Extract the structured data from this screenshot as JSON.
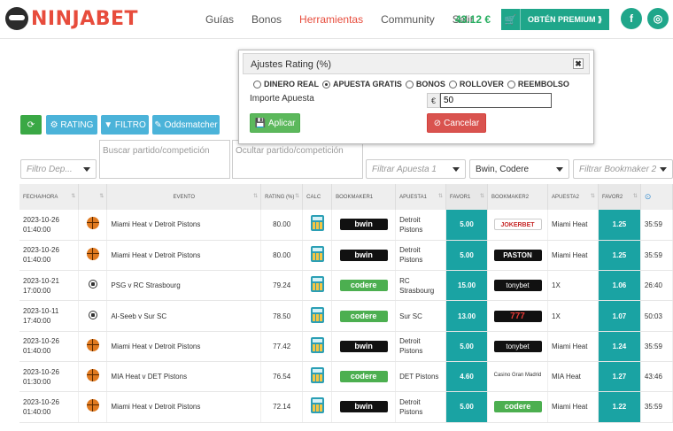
{
  "header": {
    "logo_text": "NINJABET",
    "nav": [
      "Guías",
      "Bonos",
      "Herramientas",
      "Community",
      "Salir"
    ],
    "active_nav": "Herramientas",
    "balance": "43.12 €",
    "premium_label": "OBTÉN PREMIUM ⟫",
    "social": [
      "f",
      "◎"
    ]
  },
  "toolbar": {
    "refresh_icon": "⟳",
    "rating_label": "⚙ RATING",
    "filtro_label": "▼ FILTRO",
    "odds_label": "✎ Oddsmatcher"
  },
  "filters": {
    "deporte_placeholder": "Filtro Dep...",
    "buscar_placeholder": "Buscar partido/competición",
    "ocultar_placeholder": "Ocultar partido/competición",
    "apuesta1_placeholder": "Filtrar Apuesta 1",
    "bookmaker1_value": "Bwin, Codere",
    "bookmaker2_placeholder": "Filtrar Bookmaker 2"
  },
  "modal": {
    "title": "Ajustes Rating (%)",
    "close": "✖",
    "radios": [
      {
        "label": "DINERO REAL",
        "checked": false
      },
      {
        "label": "APUESTA GRATIS",
        "checked": true
      },
      {
        "label": "BONOS",
        "checked": false
      },
      {
        "label": "ROLLOVER",
        "checked": false
      },
      {
        "label": "REEMBOLSO",
        "checked": false
      }
    ],
    "importe_label": "Importe Apuesta",
    "currency": "€",
    "importe_value": "50",
    "aplicar_label": "Aplicar",
    "cancelar_label": "Cancelar"
  },
  "table": {
    "headers": [
      "FECHA/HORA",
      "",
      "EVENTO",
      "RATING (%)",
      "CALC",
      "BOOKMAKER1",
      "APUESTA1",
      "FAVOR1",
      "BOOKMAKER2",
      "APUESTA2",
      "FAVOR2",
      "⊙"
    ],
    "rows": [
      {
        "date": "2023-10-26",
        "time": "01:40:00",
        "sport": "basket",
        "event": "Miami Heat v Detroit Pistons",
        "rating": "80.00",
        "bk1": "bwin",
        "bk1_label": "bwin",
        "apuesta1": "Detroit Pistons",
        "favor1": "5.00",
        "bk2": "jokerbet",
        "bk2_label": "JOKERBET",
        "apuesta2": "Miami Heat",
        "favor2": "1.25",
        "time_left": "35:59"
      },
      {
        "date": "2023-10-26",
        "time": "01:40:00",
        "sport": "basket",
        "event": "Miami Heat v Detroit Pistons",
        "rating": "80.00",
        "bk1": "bwin",
        "bk1_label": "bwin",
        "apuesta1": "Detroit Pistons",
        "favor1": "5.00",
        "bk2": "paston",
        "bk2_label": "PASTON",
        "apuesta2": "Miami Heat",
        "favor2": "1.25",
        "time_left": "35:59"
      },
      {
        "date": "2023-10-21",
        "time": "17:00:00",
        "sport": "soccer",
        "event": "PSG v RC Strasbourg",
        "rating": "79.24",
        "bk1": "codere",
        "bk1_label": "codere",
        "apuesta1": "RC Strasbourg",
        "favor1": "15.00",
        "bk2": "tonybet",
        "bk2_label": "tonybet",
        "apuesta2": "1X",
        "favor2": "1.06",
        "time_left": "26:40"
      },
      {
        "date": "2023-10-11",
        "time": "17:40:00",
        "sport": "soccer",
        "event": "Al-Seeb v Sur SC",
        "rating": "78.50",
        "bk1": "codere",
        "bk1_label": "codere",
        "apuesta1": "Sur SC",
        "favor1": "13.00",
        "bk2": "sietes",
        "bk2_label": "777",
        "apuesta2": "1X",
        "favor2": "1.07",
        "time_left": "50:03"
      },
      {
        "date": "2023-10-26",
        "time": "01:40:00",
        "sport": "basket",
        "event": "Miami Heat v Detroit Pistons",
        "rating": "77.42",
        "bk1": "bwin",
        "bk1_label": "bwin",
        "apuesta1": "Detroit Pistons",
        "favor1": "5.00",
        "bk2": "tonybet",
        "bk2_label": "tonybet",
        "apuesta2": "Miami Heat",
        "favor2": "1.24",
        "time_left": "35:59"
      },
      {
        "date": "2023-10-26",
        "time": "01:30:00",
        "sport": "basket",
        "event": "MIA Heat v DET Pistons",
        "rating": "76.54",
        "bk1": "codere",
        "bk1_label": "codere",
        "apuesta1": "DET Pistons",
        "favor1": "4.60",
        "bk2": "casino",
        "bk2_label": "Casino Gran Madrid",
        "apuesta2": "MIA Heat",
        "favor2": "1.27",
        "time_left": "43:46"
      },
      {
        "date": "2023-10-26",
        "time": "01:40:00",
        "sport": "basket",
        "event": "Miami Heat v Detroit Pistons",
        "rating": "72.14",
        "bk1": "bwin",
        "bk1_label": "bwin",
        "apuesta1": "Detroit Pistons",
        "favor1": "5.00",
        "bk2": "codere",
        "bk2_label": "codere",
        "apuesta2": "Miami Heat",
        "favor2": "1.22",
        "time_left": "35:59"
      }
    ]
  }
}
